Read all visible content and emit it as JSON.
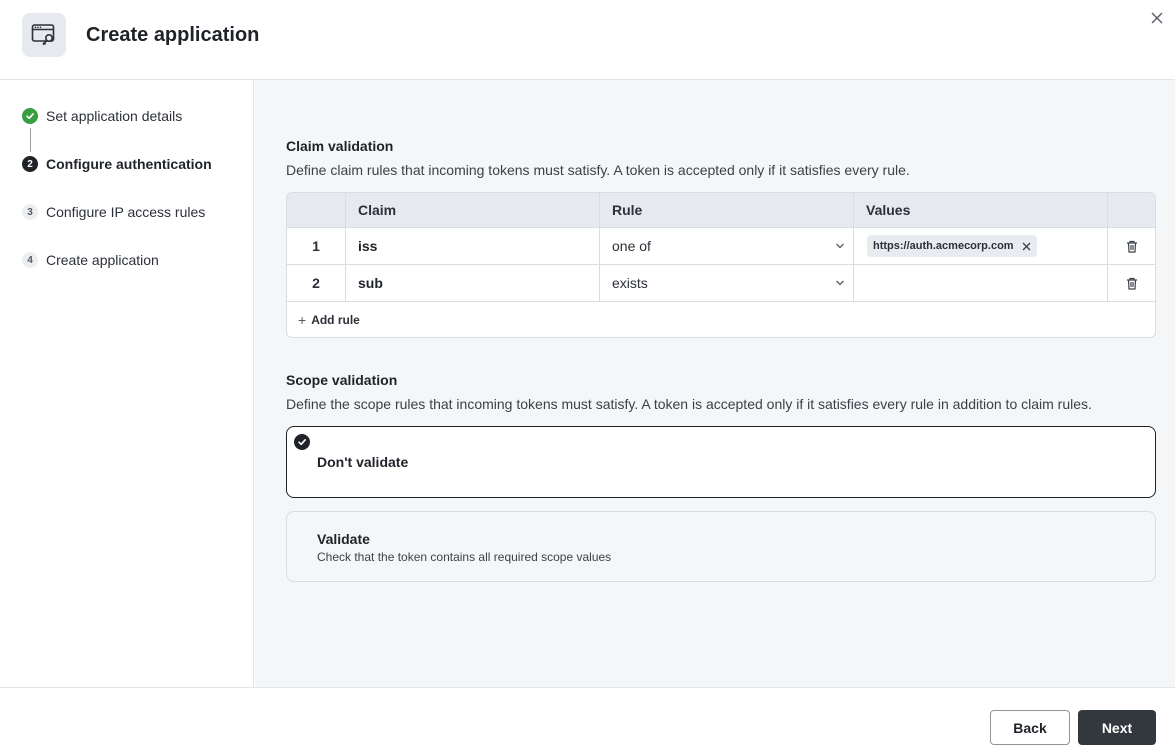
{
  "header": {
    "title": "Create application",
    "icon": "application-key-icon"
  },
  "sidebar": {
    "steps": [
      {
        "marker": "",
        "label": "Set application details",
        "state": "done"
      },
      {
        "marker": "2",
        "label": "Configure authentication",
        "state": "active"
      },
      {
        "marker": "3",
        "label": "Configure IP access rules",
        "state": "pending"
      },
      {
        "marker": "4",
        "label": "Create application",
        "state": "pending"
      }
    ]
  },
  "claims": {
    "title": "Claim validation",
    "description": "Define claim rules that incoming tokens must satisfy. A token is accepted only if it satisfies every rule.",
    "columns": [
      "",
      "Claim",
      "Rule",
      "Values",
      ""
    ],
    "rows": [
      {
        "index": "1",
        "claim": "iss",
        "rule": "one of",
        "values": [
          "https://auth.acmecorp.com"
        ]
      },
      {
        "index": "2",
        "claim": "sub",
        "rule": "exists",
        "values": []
      }
    ],
    "add_rule_label": "Add rule"
  },
  "scopes": {
    "title": "Scope validation",
    "description": "Define the scope rules that incoming tokens must satisfy. A token is accepted only if it satisfies every rule in addition to claim rules.",
    "options": [
      {
        "title": "Don't validate",
        "subtitle": "",
        "selected": true
      },
      {
        "title": "Validate",
        "subtitle": "Check that the token contains all required scope values",
        "selected": false
      }
    ]
  },
  "footer": {
    "back_label": "Back",
    "next_label": "Next"
  },
  "colors": {
    "success": "#3a9d3f",
    "primary_button": "#33383f",
    "content_bg": "#f5f6f8"
  }
}
